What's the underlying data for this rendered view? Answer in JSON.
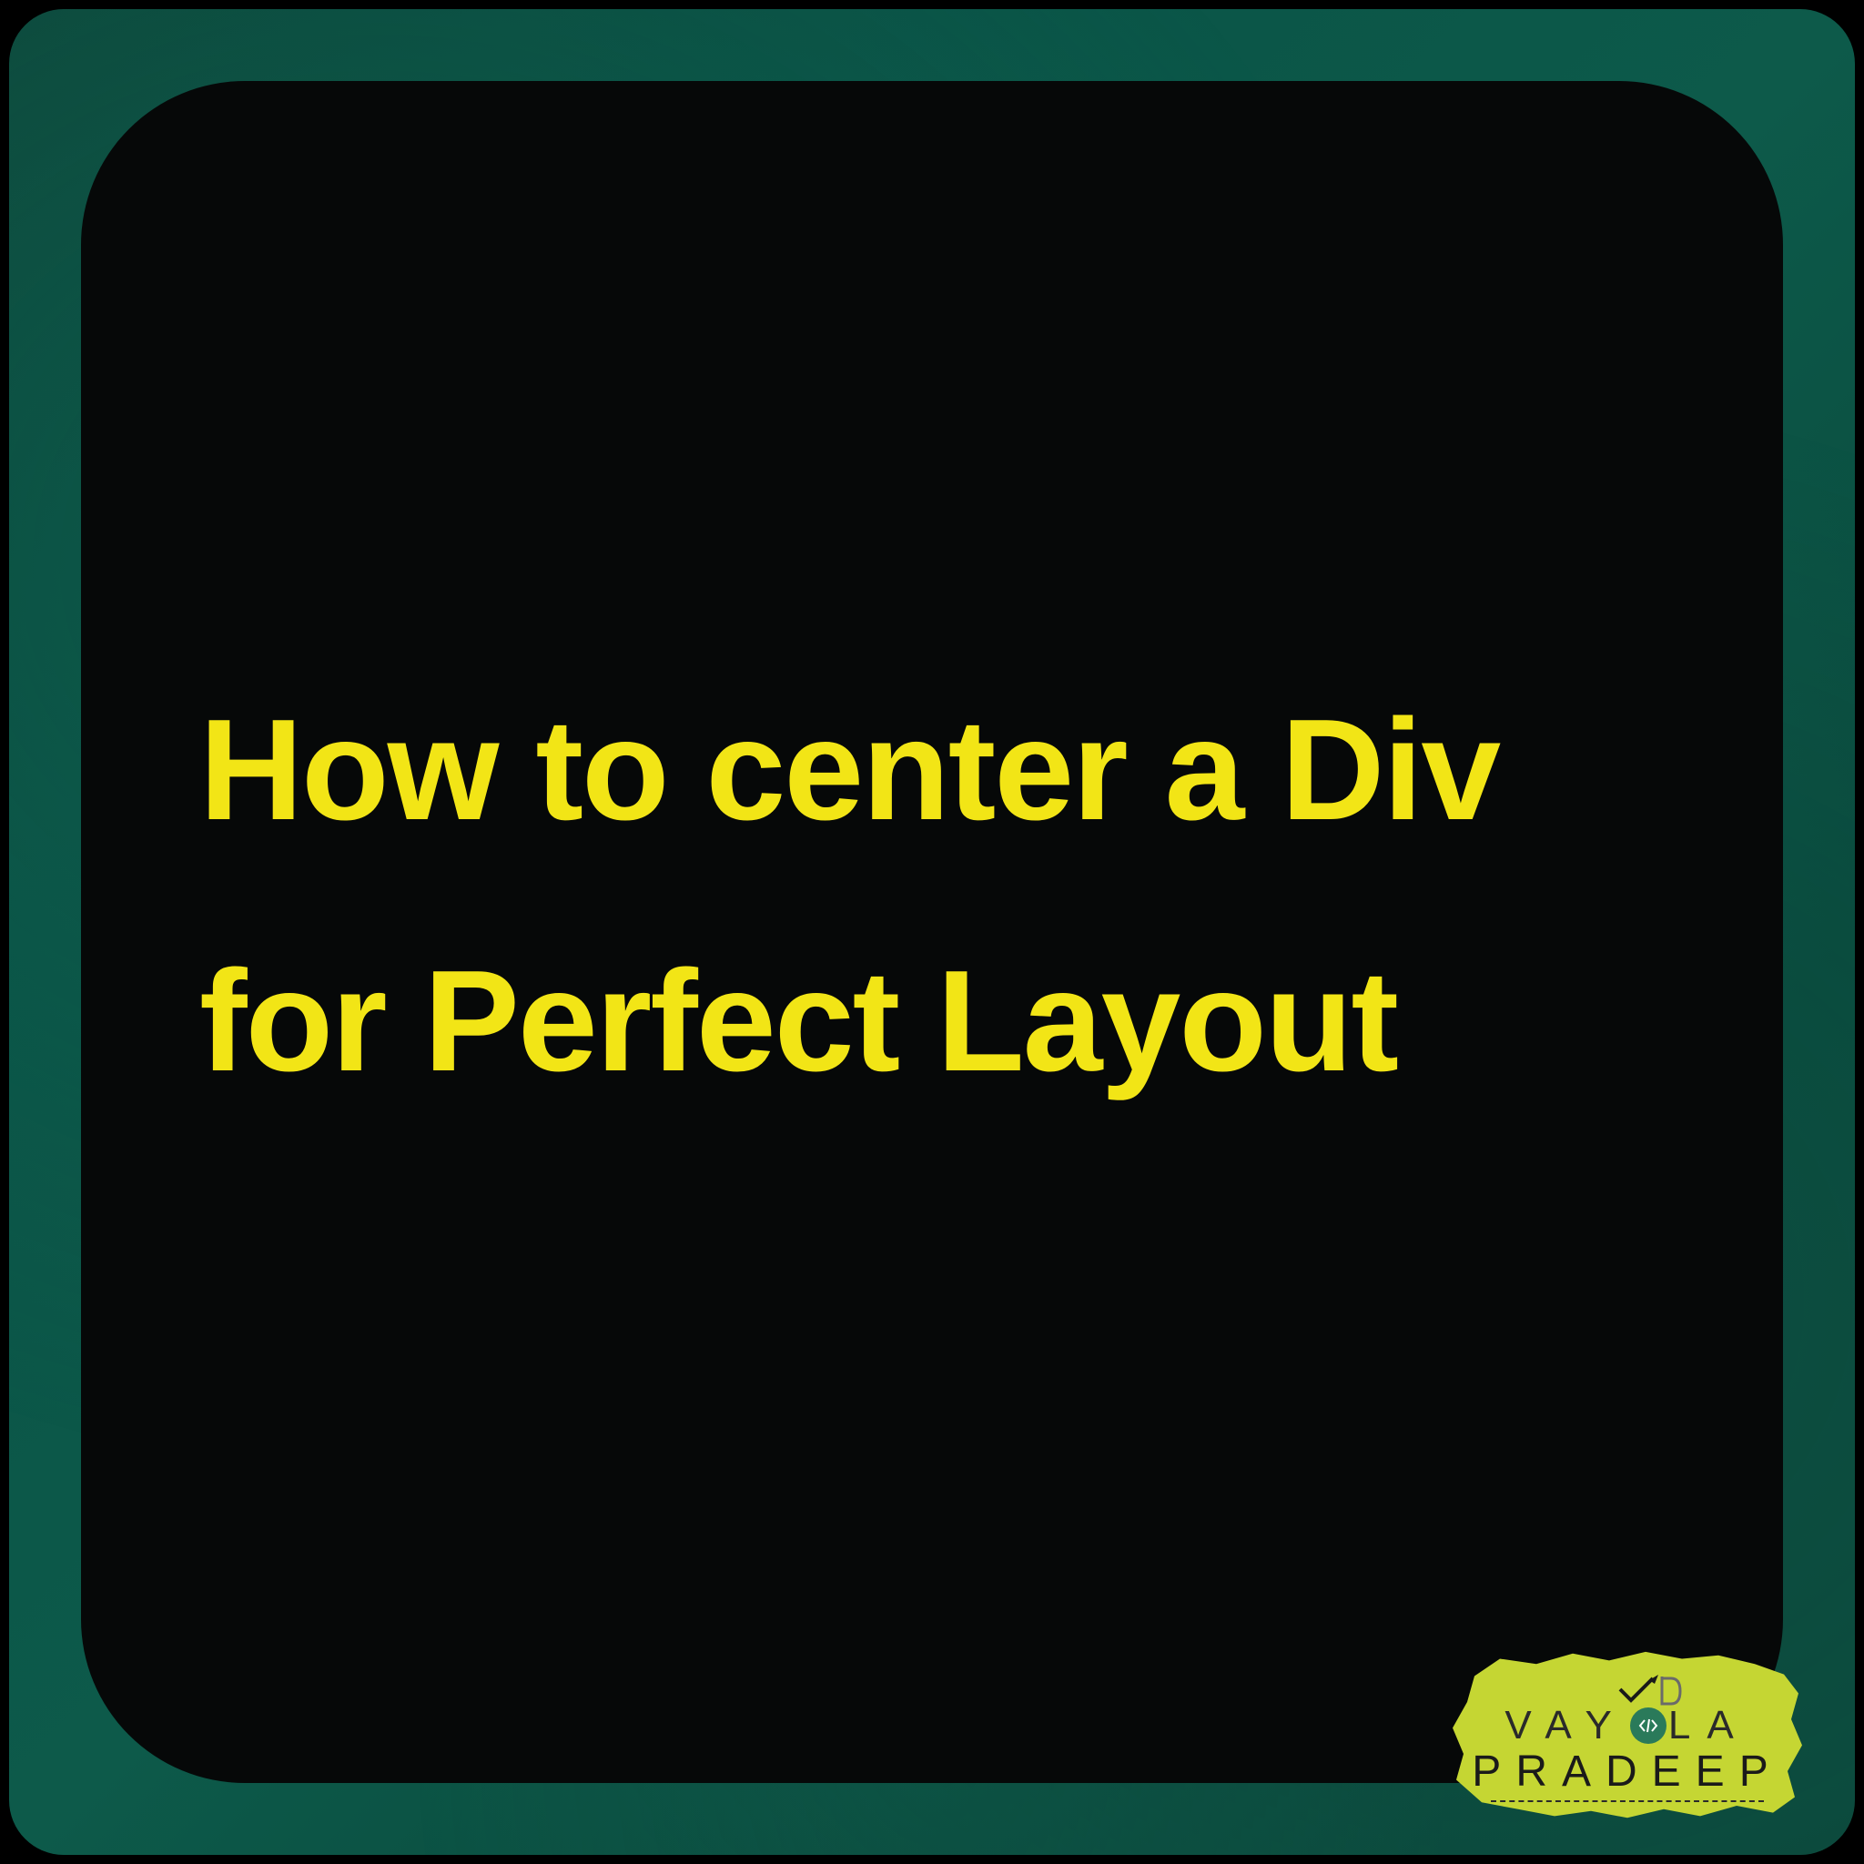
{
  "card": {
    "title": "How to center a Div for Perfect Layout"
  },
  "badge": {
    "line1_part1": "VAY",
    "line1_part2": "LA",
    "line2": "PRADEEP",
    "icon_arrow": "arrow-up-right",
    "icon_code": "code-brackets"
  },
  "colors": {
    "frame_bg": "#0d4a3d",
    "card_bg": "#060808",
    "title_text": "#f2e516",
    "badge_bg": "#c5d633"
  }
}
